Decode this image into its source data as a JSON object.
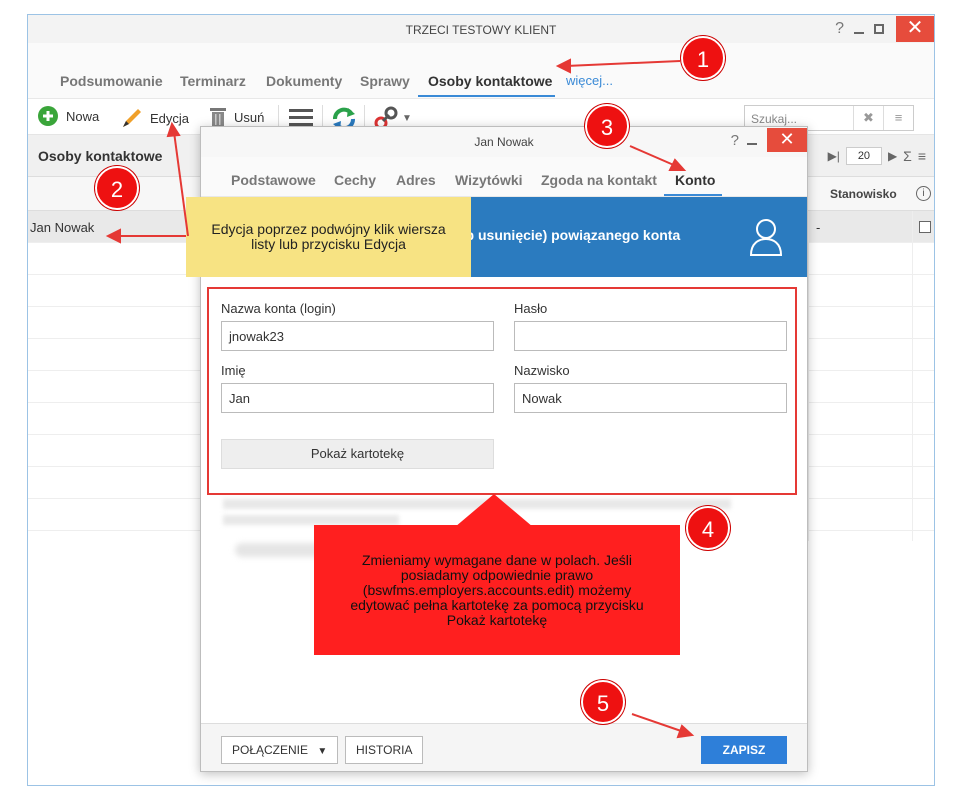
{
  "window": {
    "title": "TRZECI TESTOWY KLIENT",
    "help": "?",
    "close": "✕"
  },
  "tabs": [
    "Podsumowanie",
    "Terminarz",
    "Dokumenty",
    "Sprawy",
    "Osoby kontaktowe",
    "więcej..."
  ],
  "toolbar": {
    "new": "Nowa",
    "edit": "Edycja",
    "delete": "Usuń",
    "search_placeholder": "Szukaj...",
    "search_clear": "✖",
    "search_menu": "≡"
  },
  "list": {
    "title": "Osoby kontaktowe",
    "page_size": "20",
    "column_position": "Stanowisko",
    "info": "i",
    "row_name": "Jan Nowak",
    "row_position": "-"
  },
  "dialog": {
    "title": "Jan Nowak",
    "help": "?",
    "close": "✕",
    "tabs": [
      "Podstawowe",
      "Cechy",
      "Adres",
      "Wizytówki",
      "Zgoda na kontakt",
      "Konto"
    ],
    "banner_text": "ub usunięcie) powiązanego konta",
    "form": {
      "login_label": "Nazwa konta (login)",
      "login_value": "jnowak23",
      "password_label": "Hasło",
      "password_value": "",
      "first_name_label": "Imię",
      "first_name_value": "Jan",
      "last_name_label": "Nazwisko",
      "last_name_value": "Nowak",
      "show_card": "Pokaż kartotekę"
    },
    "footer": {
      "connection": "POŁĄCZENIE",
      "history": "HISTORIA",
      "save": "ZAPISZ"
    }
  },
  "annotations": {
    "yellow": "Edycja poprzez podwójny klik wiersza listy lub przycisku Edycja",
    "red": "Zmieniamy wymagane dane w polach. Jeśli posiadamy odpowiednie prawo (bswfms.employers.accounts.edit) możemy edytować pełna kartotekę za pomocą przycisku Pokaż kartotekę",
    "badges": [
      "1",
      "2",
      "3",
      "4",
      "5"
    ]
  },
  "colors": {
    "accent": "#3a8ad6",
    "banner": "#2b7bbf",
    "save": "#2e7fd9",
    "close": "#e64c3c",
    "annotation_red": "#ff1f1f",
    "annotation_yellow": "#f7e383"
  }
}
